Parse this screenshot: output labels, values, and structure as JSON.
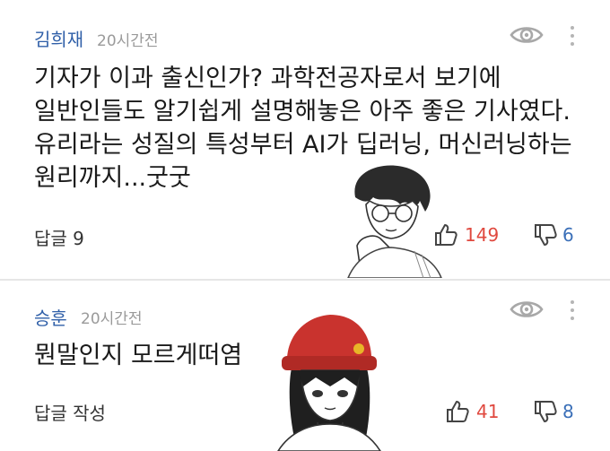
{
  "comments": [
    {
      "author": "김희재",
      "time": "20시간전",
      "lines": [
        "기자가 이과 출신인가? 과학전공자로서 보기에",
        "일반인들도 알기쉽게 설명해놓은 아주 좋은 기사였다.",
        "유리라는 성질의 특성부터 AI가 딥러닝, 머신러닝하는",
        "원리까지...굿굿"
      ],
      "reply_label": "답글 9",
      "likes": "149",
      "dislikes": "6"
    },
    {
      "author": "승훈",
      "time": "20시간전",
      "lines": [
        "뭔말인지 모르게떠염"
      ],
      "reply_label": "답글 작성",
      "likes": "41",
      "dislikes": "8"
    }
  ],
  "colors": {
    "author": "#2f5fa8",
    "like": "#e0493f",
    "dislike": "#3a6fb8",
    "meta": "#9a9a9a"
  },
  "icons": {
    "view": "eye-icon",
    "more": "kebab-icon",
    "like": "thumb-up-icon",
    "dislike": "thumb-down-icon"
  }
}
